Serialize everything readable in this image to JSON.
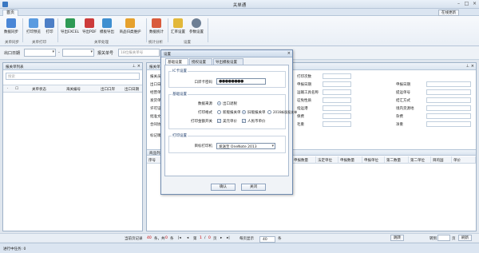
{
  "window": {
    "title": "关单通"
  },
  "tabs": {
    "home": "首页",
    "online_update": "在线更新"
  },
  "ribbon": {
    "buttons": [
      {
        "label": "数据同步",
        "color": "#4a86d6"
      },
      {
        "label": "打印预览",
        "color": "#5a9be0"
      },
      {
        "label": "打印",
        "color": "#4d7fc6"
      },
      {
        "label": "导出EXCEL",
        "color": "#2e9a55"
      },
      {
        "label": "导出PDF",
        "color": "#cc3b3b"
      },
      {
        "label": "模板导出",
        "color": "#3f8fd0"
      },
      {
        "label": "商品归类维护",
        "color": "#e6a12d"
      },
      {
        "label": "数据统计",
        "color": "#d95b3c"
      },
      {
        "label": "汇率设置",
        "color": "#e2b83a"
      },
      {
        "label": "参数设置",
        "color": "#6d7f95"
      }
    ],
    "groups": [
      "关单同步",
      "关单打印",
      "关单处理",
      "统计分析",
      "设置"
    ]
  },
  "filter": {
    "date_label": "出口日期",
    "date_sep": "-",
    "number_label": "报关单号",
    "number_placeholder": "18位报关单号"
  },
  "left_panel": {
    "title": "报关单列表",
    "search_placeholder": "搜索",
    "columns": [
      "关单状态",
      "海关编号",
      "出口口岸",
      "出口日期"
    ]
  },
  "right_panel": {
    "title": "报关单",
    "left_labels": [
      "报关员",
      "出口日期",
      "经营单位",
      "发货单位",
      "许可证号",
      "批准文号",
      "合同协议号"
    ],
    "side_labels": [
      "标记唛码"
    ],
    "right_labels": {
      "print_count": "打印次数",
      "declare_date": "申报日期",
      "transport": "运输工具名称",
      "bill_no": "提运单号",
      "trade_mode": "征免性质",
      "settle": "结汇方式",
      "dest": "指运港",
      "origin": "境内货源地",
      "insurance": "保费",
      "misc": "杂费",
      "gross": "毛重",
      "net": "净重"
    },
    "goods_section": "商品列表",
    "goods_columns": [
      "序号",
      "申报数量",
      "法定单位",
      "申报数量",
      "申报单位",
      "第二数量",
      "第二单位",
      "目的国",
      "单价"
    ]
  },
  "pager": {
    "current_records_label": "当前页记录",
    "current_records": "40",
    "total_records_label": "条，共",
    "total_records": "0",
    "records_unit": "条",
    "page_label": "第",
    "page_current": "1",
    "page_sep": "/",
    "page_total": "0",
    "page_unit": "页",
    "per_page_label": "每页显示",
    "per_page": "40",
    "per_page_unit": "条",
    "goto_label": "转到",
    "goto_unit": "页",
    "goto_button": "跳转",
    "refresh_button": "刷新"
  },
  "status": {
    "text": "进行中任务: 0"
  },
  "dialog": {
    "title": "设置",
    "tabs": [
      "基础设置",
      "授权设置",
      "导出模板设置"
    ],
    "ic_section": "IC卡设置",
    "ic_password_label": "口岸卡密码",
    "ic_password_value": "●●●●●●●●",
    "basic_section": "基础设置",
    "data_source_label": "数据来源",
    "data_source_options": [
      "出口退税"
    ],
    "print_format_label": "打印格式",
    "print_format_options": [
      "新版报关单",
      "旧版报关单",
      "2016新版报关单"
    ],
    "print_switch_label": "打印金额开关",
    "print_switch_options": [
      "美元单价",
      "人民币单价"
    ],
    "print_section": "打印设置",
    "printer_label": "目标打印机",
    "printer_value": "发送至 OneNote 2013",
    "ok_button": "确认",
    "close_button": "关闭"
  }
}
